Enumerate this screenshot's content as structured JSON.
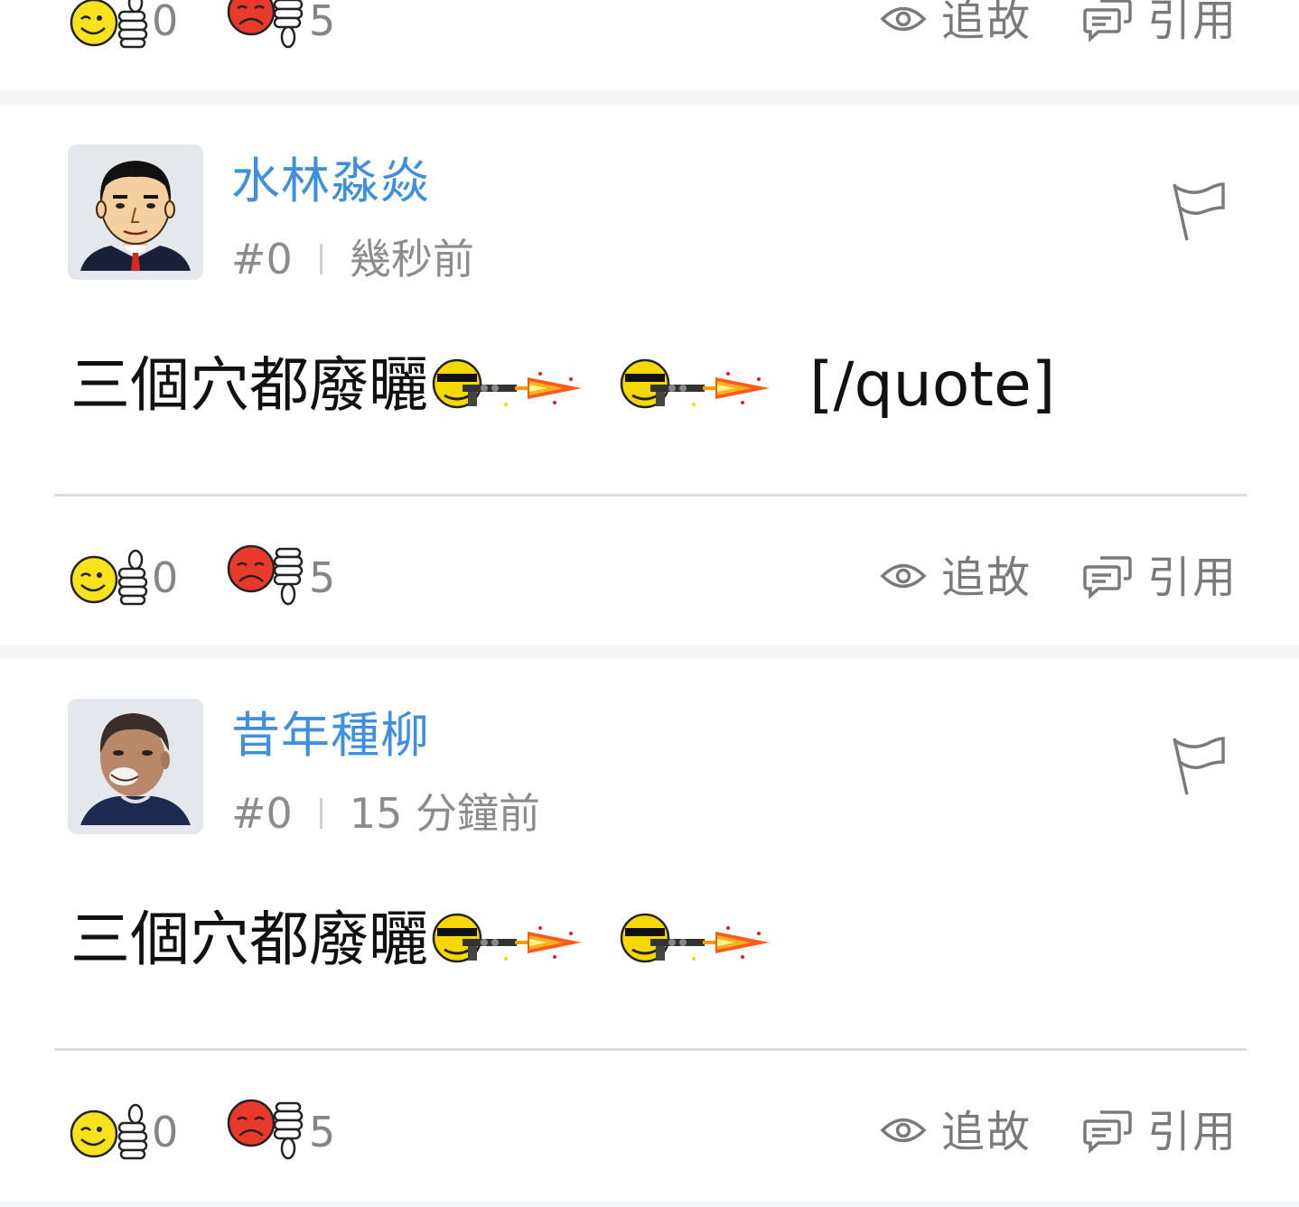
{
  "actions": {
    "follow_label": "追故",
    "quote_label": "引用"
  },
  "top_bar": {
    "likes": "0",
    "dislikes": "5"
  },
  "posts": [
    {
      "username": "水林淼焱",
      "floor": "#0",
      "time": "幾秒前",
      "content_text": "三個穴都廢曬",
      "content_trailing": "[/quote]",
      "likes": "0",
      "dislikes": "5"
    },
    {
      "username": "昔年種柳",
      "floor": "#0",
      "time": "15 分鐘前",
      "content_text": "三個穴都廢曬",
      "likes": "0",
      "dislikes": "5"
    }
  ],
  "icons": {
    "like": "thumbs-up-smiley-icon",
    "dislike": "thumbs-down-sad-icon",
    "follow": "eye-icon",
    "quote": "speech-bubble-icon",
    "report": "flag-icon",
    "content_emoji": "gun-smiley-icon"
  },
  "colors": {
    "username": "#3f8fde",
    "meta": "#8c8c8c",
    "action": "#7a7a7a",
    "background": "#f4f5f6",
    "card": "#ffffff"
  }
}
